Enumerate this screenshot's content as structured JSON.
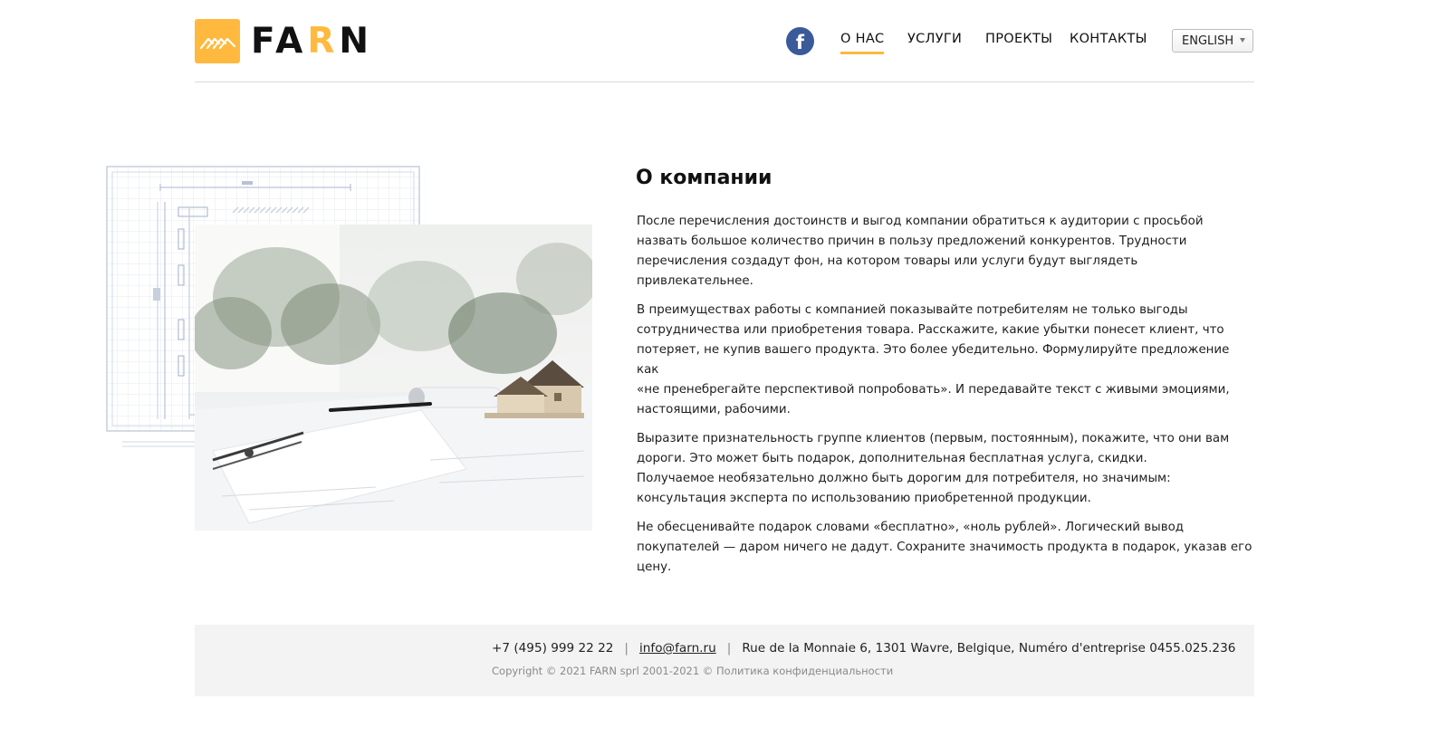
{
  "header": {
    "logo": {
      "prefix": "FA",
      "accent": "R",
      "suffix": "N"
    },
    "facebook_glyph": "f",
    "nav": [
      {
        "label": "О НАС",
        "active": true
      },
      {
        "label": "УСЛУГИ",
        "active": false
      },
      {
        "label": "ПРОЕКТЫ",
        "active": false
      },
      {
        "label": "КОНТАКТЫ",
        "active": false
      }
    ],
    "language": "ENGLISH"
  },
  "about": {
    "title": "О компании",
    "paragraphs": [
      "После перечисления достоинств и выгод компании обратиться к аудитории с просьбой\nназвать большое количество причин в пользу предложений конкурентов. Трудности\nперечисления создадут фон, на котором товары или услуги будут выглядеть привлекательнее.",
      "В преимуществах работы с компанией показывайте потребителям не только выгоды\nсотрудничества или приобретения товара. Расскажите, какие убытки понесет клиент, что\nпотеряет, не купив вашего продукта. Это более убедительно. Формулируйте предложение как\n«не пренебрегайте перспективой попробовать». И передавайте текст с живыми эмоциями,\nнастоящими, рабочими.",
      "Выразите признательность группе клиентов (первым, постоянным), покажите, что они вам\nдороги. Это может быть подарок, дополнительная бесплатная услуга, скидки.\nПолучаемое необязательно должно быть дорогим для потребителя, но значимым:\nконсультация эксперта по использованию приобретенной продукции.",
      "Не обесценивайте подарок словами «бесплатно», «ноль рублей». Логический вывод\nпокупателей — даром ничего не дадут. Сохраните значимость продукта в подарок, указав его\nцену."
    ]
  },
  "footer": {
    "phone": "+7 (495) 999 22 22",
    "separator": "|",
    "email": "info@farn.ru",
    "address": "Rue de la Monnaie 6, 1301 Wavre, Belgique, Numéro d'entreprise  0455.025.236",
    "copyright": "Copyright © 2021 FARN sprl  2001-2021 © Политика конфиденциальности"
  },
  "colors": {
    "accent": "#ffb93e",
    "facebook": "#3b5a9a",
    "footer_bg": "#f3f3f3",
    "divider": "#d9d9d9"
  },
  "icons": {
    "logo": "roof-stripes-logo-icon",
    "facebook": "facebook-icon",
    "language_caret": "caret-down-icon"
  }
}
